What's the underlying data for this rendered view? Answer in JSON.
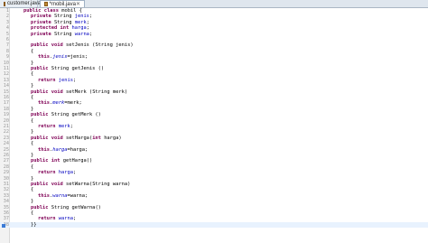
{
  "tabs": [
    {
      "label": "customer.java",
      "active": false
    },
    {
      "label": "*mobil.java",
      "active": true
    }
  ],
  "code_lines": [
    {
      "num": "1",
      "text": "public class mobil {",
      "indent": 0
    },
    {
      "num": "2",
      "text": "private String jenis;",
      "indent": 1
    },
    {
      "num": "3",
      "text": "private String merk;",
      "indent": 1
    },
    {
      "num": "4",
      "text": "protected int harga;",
      "indent": 1
    },
    {
      "num": "5",
      "text": "private String warna;",
      "indent": 1
    },
    {
      "num": "6",
      "text": "",
      "indent": 0
    },
    {
      "num": "7",
      "text": "public void setJenis (String jenis)",
      "indent": 1
    },
    {
      "num": "8",
      "text": "{",
      "indent": 1
    },
    {
      "num": "9",
      "text": "this.jenis=jenis;",
      "indent": 2
    },
    {
      "num": "10",
      "text": "}",
      "indent": 1
    },
    {
      "num": "11",
      "text": "public String getJenis ()",
      "indent": 1
    },
    {
      "num": "12",
      "text": "{",
      "indent": 1
    },
    {
      "num": "13",
      "text": "return jenis;",
      "indent": 2
    },
    {
      "num": "14",
      "text": "}",
      "indent": 1
    },
    {
      "num": "15",
      "text": "public void setMerk (String merk)",
      "indent": 1
    },
    {
      "num": "16",
      "text": "{",
      "indent": 1
    },
    {
      "num": "17",
      "text": "this.merk=merk;",
      "indent": 2
    },
    {
      "num": "18",
      "text": "}",
      "indent": 1
    },
    {
      "num": "19",
      "text": "public String getMerk ()",
      "indent": 1
    },
    {
      "num": "20",
      "text": "{",
      "indent": 1
    },
    {
      "num": "21",
      "text": "return merk;",
      "indent": 2
    },
    {
      "num": "22",
      "text": "}",
      "indent": 1
    },
    {
      "num": "23",
      "text": "public void setHarga(int harga)",
      "indent": 1
    },
    {
      "num": "24",
      "text": "{",
      "indent": 1
    },
    {
      "num": "25",
      "text": "this.harga=harga;",
      "indent": 2
    },
    {
      "num": "26",
      "text": "}",
      "indent": 1
    },
    {
      "num": "27",
      "text": "public int getHarga()",
      "indent": 1
    },
    {
      "num": "28",
      "text": "{",
      "indent": 1
    },
    {
      "num": "29",
      "text": "return harga;",
      "indent": 2
    },
    {
      "num": "30",
      "text": "}",
      "indent": 1
    },
    {
      "num": "31",
      "text": "public void setWarna(String warna)",
      "indent": 1
    },
    {
      "num": "32",
      "text": "{",
      "indent": 1
    },
    {
      "num": "33",
      "text": "this.warna=warna;",
      "indent": 2
    },
    {
      "num": "34",
      "text": "}",
      "indent": 1
    },
    {
      "num": "35",
      "text": "public String getWarna()",
      "indent": 1
    },
    {
      "num": "36",
      "text": "{",
      "indent": 1
    },
    {
      "num": "37",
      "text": "return warna;",
      "indent": 2
    },
    {
      "num": "38",
      "text": "}}",
      "indent": 1,
      "current": true
    }
  ],
  "colors": {
    "keyword": "#7f0055",
    "field": "#0000c0",
    "text": "#000000",
    "line_number": "#9a9a9a",
    "current_line": "#e8f2fe"
  }
}
